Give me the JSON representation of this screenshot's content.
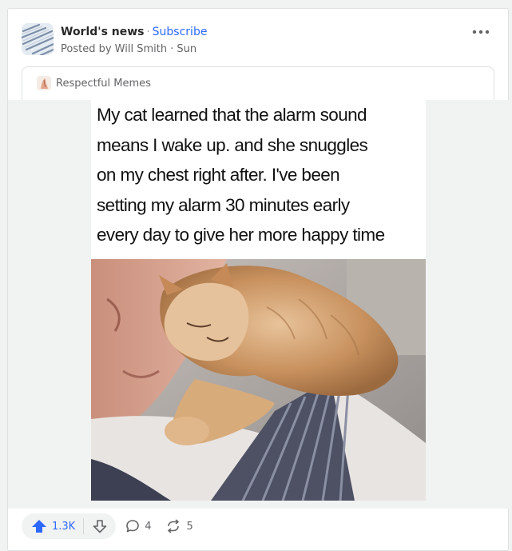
{
  "post": {
    "space_name": "World's news",
    "subscribe_label": "Subscribe",
    "posted_by": "Posted by Will Smith",
    "time": "· Sun",
    "more_icon": "more-horizontal-icon"
  },
  "source": {
    "name": "Respectful Memes",
    "icon": "space-icon"
  },
  "meme": {
    "lines": [
      "My cat learned that the alarm sound",
      "means I wake up. and she snuggles",
      "on my chest right after. I've been",
      "setting my alarm 30 minutes early",
      "every day to give her more happy time"
    ]
  },
  "actions": {
    "upvote_count": "1.3K",
    "comment_count": "4",
    "share_count": "5",
    "upvote_color": "#2e69ff"
  }
}
